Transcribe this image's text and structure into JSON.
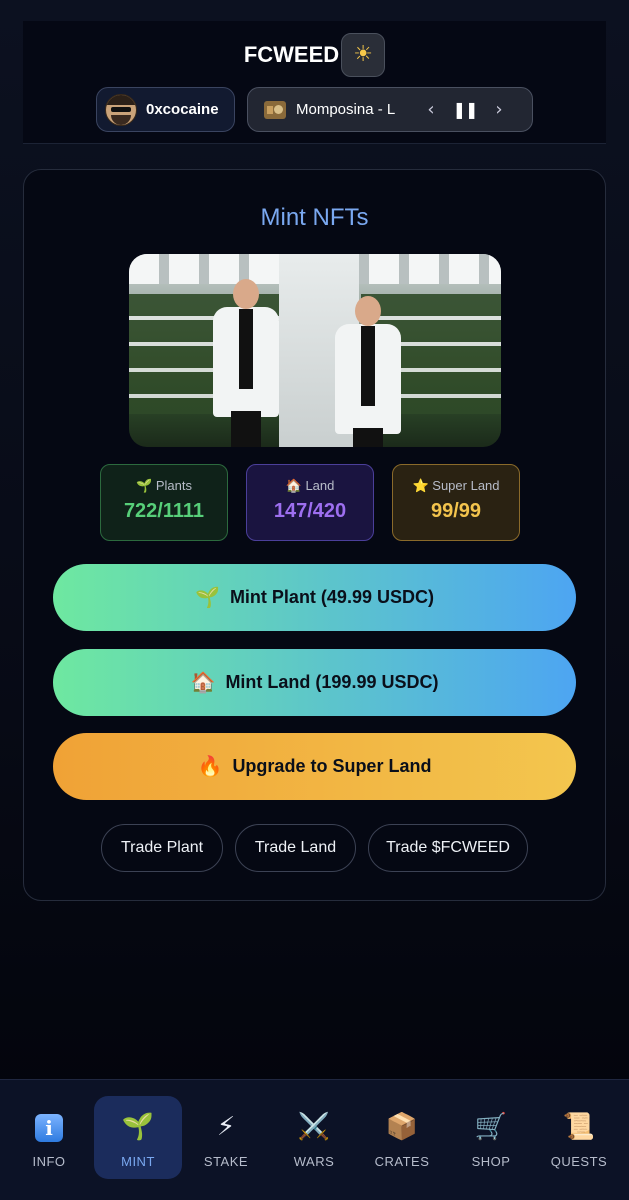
{
  "header": {
    "title": "FCWEED",
    "theme_icon": "sun-icon",
    "user": {
      "name": "0xcocaine",
      "avatar_icon": "avatar"
    },
    "player": {
      "song": "Momposina - L",
      "prev": "‹",
      "pause": "❚❚",
      "next": "›",
      "radio_icon": "radio-icon"
    }
  },
  "mint": {
    "title": "Mint NFTs",
    "stats": [
      {
        "icon": "🌱",
        "label": "Plants",
        "value": "722/1111"
      },
      {
        "icon": "🏠",
        "label": "Land",
        "value": "147/420"
      },
      {
        "icon": "⭐",
        "label": "Super Land",
        "value": "99/99"
      }
    ],
    "buttons": {
      "mint_plant": {
        "icon": "🌱",
        "label": "Mint Plant (49.99 USDC)"
      },
      "mint_land": {
        "icon": "🏠",
        "label": "Mint Land (199.99 USDC)"
      },
      "upgrade": {
        "icon": "🔥",
        "label": "Upgrade to Super Land"
      }
    },
    "trade": [
      "Trade Plant",
      "Trade Land",
      "Trade $FCWEED"
    ]
  },
  "nav": {
    "active": "MINT",
    "items": [
      {
        "icon": "i",
        "label": "INFO"
      },
      {
        "icon": "🌱",
        "label": "MINT"
      },
      {
        "icon": "⚡",
        "label": "STAKE"
      },
      {
        "icon": "⚔️",
        "label": "WARS"
      },
      {
        "icon": "📦",
        "label": "CRATES"
      },
      {
        "icon": "🛒",
        "label": "SHOP"
      },
      {
        "icon": "📜",
        "label": "QUESTS"
      }
    ]
  },
  "colors": {
    "accent": "#7aa8f0",
    "plants": "#57cf79",
    "land": "#9d6ff0",
    "super_land": "#f3c44d"
  }
}
